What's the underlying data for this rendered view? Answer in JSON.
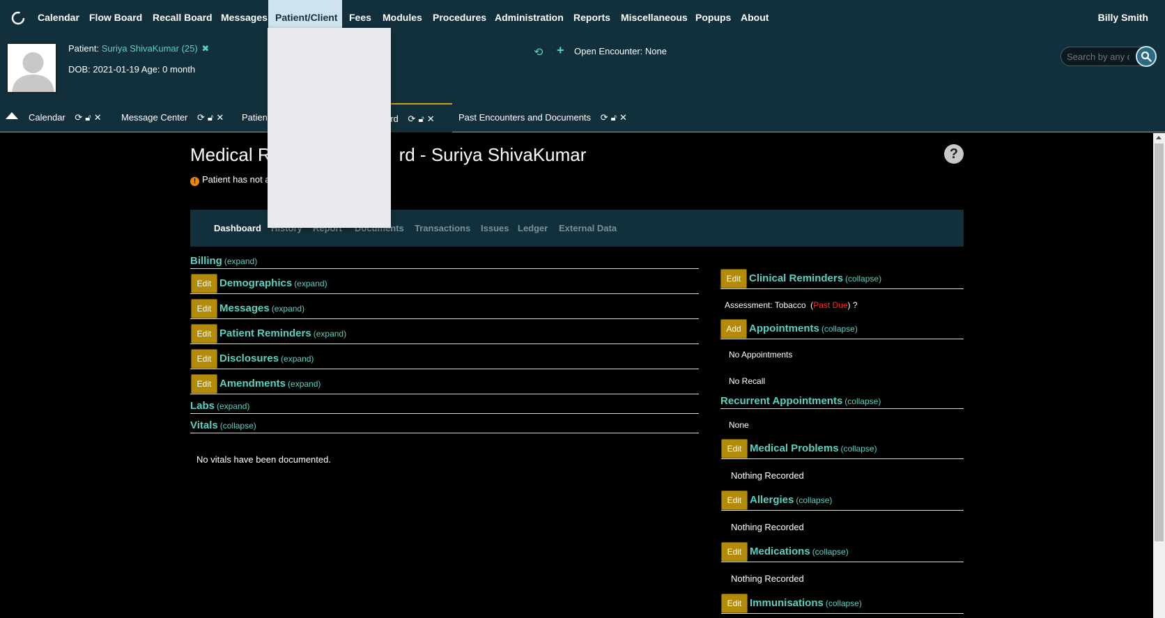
{
  "menu": {
    "items": [
      "Calendar",
      "Flow Board",
      "Recall Board",
      "Messages",
      "Patient/Client",
      "Fees",
      "Modules",
      "Procedures",
      "Administration",
      "Reports",
      "Miscellaneous",
      "Popups",
      "About"
    ],
    "active": "Patient/Client",
    "user": "Billy Smith"
  },
  "patient": {
    "label": "Patient:",
    "name": "Suriya ShivaKumar (25)",
    "dob_line": "DOB: 2021-01-19 Age: 0 month"
  },
  "encounter": {
    "text": "Open Encounter: None"
  },
  "search": {
    "placeholder": "Search by any demographics"
  },
  "tabs": [
    {
      "label": "Calendar"
    },
    {
      "label": "Message Center"
    },
    {
      "label": "Patien"
    },
    {
      "label": "ard"
    },
    {
      "label": "Past Encounters and Documents"
    }
  ],
  "page": {
    "title": "Medical R",
    "title_end": "rd - Suriya ShivaKumar",
    "warning": "Patient has not a"
  },
  "subnav": [
    "Dashboard",
    "History",
    "Report",
    "Documents",
    "Transactions",
    "Issues",
    "Ledger",
    "External Data"
  ],
  "left_sections": {
    "billing": {
      "title": "Billing",
      "toggle": "(expand)"
    },
    "demographics": {
      "title": "Demographics",
      "toggle": "(expand)",
      "button": "Edit"
    },
    "messages": {
      "title": "Messages",
      "toggle": "(expand)",
      "button": "Edit"
    },
    "patient_reminders": {
      "title": "Patient Reminders",
      "toggle": "(expand)",
      "button": "Edit"
    },
    "disclosures": {
      "title": "Disclosures",
      "toggle": "(expand)",
      "button": "Edit"
    },
    "amendments": {
      "title": "Amendments",
      "toggle": "(expand)",
      "button": "Edit"
    },
    "labs": {
      "title": "Labs",
      "toggle": "(expand)"
    },
    "vitals": {
      "title": "Vitals",
      "toggle": "(collapse)",
      "body": "No vitals have been documented."
    }
  },
  "right_sections": {
    "clinical_reminders": {
      "title": "Clinical Reminders",
      "toggle": "(collapse)",
      "button": "Edit",
      "item_prefix": "Assessment: Tobacco",
      "item_status": "Past Due",
      "item_suffix": "?"
    },
    "appointments": {
      "title": "Appointments",
      "toggle": "(collapse)",
      "button": "Add",
      "body": "No Appointments",
      "recall": "No Recall"
    },
    "recurrent": {
      "title": "Recurrent Appointments",
      "toggle": "(collapse)",
      "body": "None"
    },
    "medical_problems": {
      "title": "Medical Problems",
      "toggle": "(collapse)",
      "button": "Edit",
      "body": "Nothing Recorded"
    },
    "allergies": {
      "title": "Allergies",
      "toggle": "(collapse)",
      "button": "Edit",
      "body": "Nothing Recorded"
    },
    "medications": {
      "title": "Medications",
      "toggle": "(collapse)",
      "button": "Edit",
      "body": "Nothing Recorded"
    },
    "immunisations": {
      "title": "Immunisations",
      "toggle": "(collapse)",
      "button": "Edit"
    }
  },
  "colors": {
    "header_bg": "#12303b",
    "accent_teal": "#5ad1c1",
    "button_gold": "#b38b08",
    "past_due_red": "#ff2a2a"
  }
}
